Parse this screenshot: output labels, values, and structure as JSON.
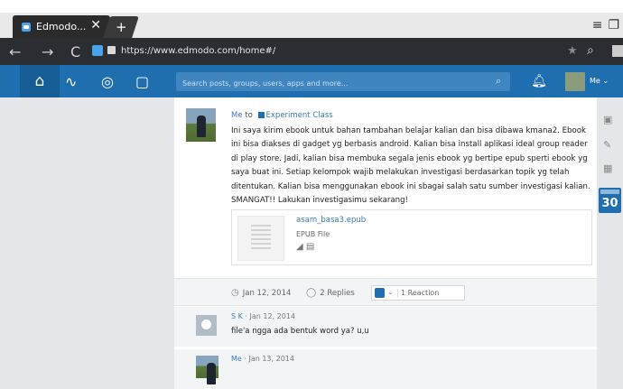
{
  "browser": {
    "tab_title": "Edmodo...",
    "tab_close": "✕",
    "new_tab": "+",
    "url": "https://www.edmodo.com/home#/"
  },
  "app": {
    "search_placeholder": "Search posts, groups, users, apps and more...",
    "user_label": "Me ⌄"
  },
  "post": {
    "author": "Me",
    "to_word": "to",
    "group": "Experiment Class",
    "body": "Ini saya kirim ebook untuk bahan tambahan belajar kalian dan bisa dibawa kmana2. Ebook ini bisa diakses di gadget yg berbasis android. Kalian bisa install aplikasi ideal group reader di play store. Jadi, kalian bisa membuka segala jenis ebook yg bertipe epub sperti ebook yg saya buat ini. Setiap kelompok wajib melakukan investigasi berdasarkan topik yg telah ditentukan. Kalian bisa menggunakan ebook ini sbagai salah satu sumber investigasi kalian. SMANGAT!! Lakukan investigasimu sekarang!",
    "attachment": {
      "name": "asam_basa3.epub",
      "type": "EPUB File"
    },
    "meta": {
      "date": "Jan 12, 2014",
      "replies": "2 Replies",
      "reaction": "1 Reaction"
    }
  },
  "replies": [
    {
      "author": "S K",
      "date": "Jan 12, 2014",
      "text": "file'a ngga ada bentuk word ya? u,u"
    },
    {
      "author": "Me",
      "date": "Jan 13, 2014",
      "text": ""
    }
  ],
  "calendar": {
    "day": "30"
  },
  "colors": {
    "brand": "#1f6fb0",
    "link": "#3b7ab5"
  }
}
